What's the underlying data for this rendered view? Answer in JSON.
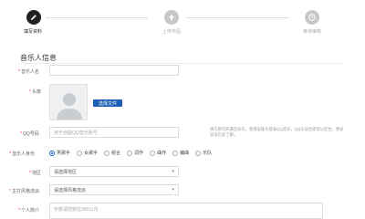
{
  "steps": [
    {
      "label": "填写资料",
      "state": "active",
      "icon": "pencil-icon"
    },
    {
      "label": "上传作品",
      "state": "inactive",
      "icon": "arrow-up-icon"
    },
    {
      "label": "等待审核",
      "state": "inactive",
      "icon": "clock-icon"
    }
  ],
  "colors": {
    "accent": "#1a5fb4",
    "active_step": "#222222",
    "inactive_step": "#c8c8c8",
    "required": "#e33333"
  },
  "section_title": "音乐人信息",
  "form": {
    "name": {
      "label": "音乐人名",
      "value": "",
      "placeholder": ""
    },
    "avatar": {
      "label": "头像",
      "button": "选择文件"
    },
    "qq": {
      "label": "QQ号码",
      "placeholder": "用于创建QQ音乐账号",
      "hint": "填写即可开通音乐号，使用该账号登录QQ音乐，QQ认证后即可以后台，更多说法在此了解。"
    },
    "identity": {
      "label": "音乐人身份",
      "options": [
        "男歌手",
        "女歌手",
        "组合",
        "词作",
        "曲作",
        "编曲",
        "乐队"
      ],
      "selected": 0
    },
    "region": {
      "label": "地区",
      "value": "请选择地区"
    },
    "style": {
      "label": "主打风格流派",
      "value": "请选择风格流派"
    },
    "intro": {
      "label": "个人简介",
      "placeholder": "字数请控制在300以内"
    }
  }
}
